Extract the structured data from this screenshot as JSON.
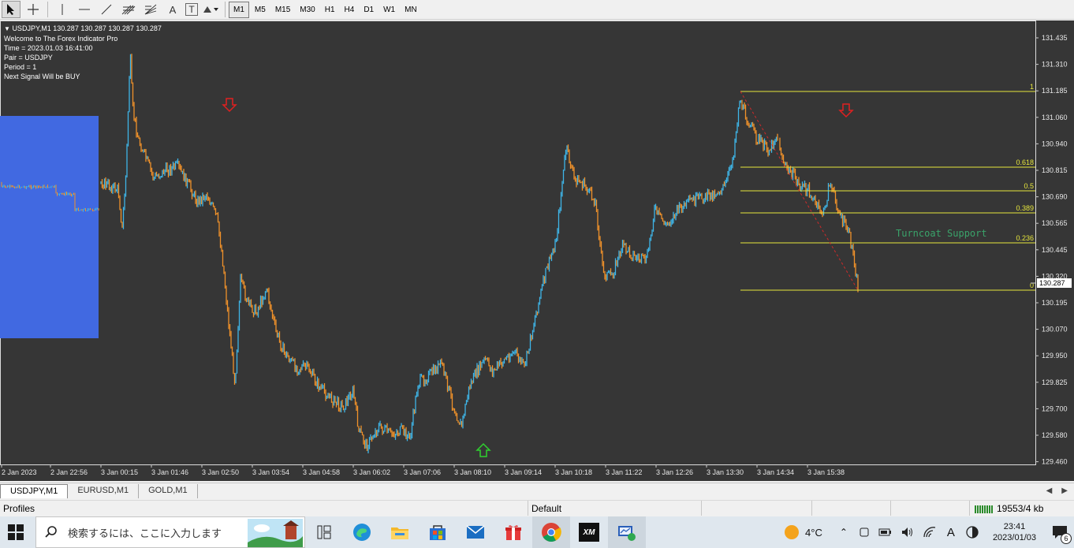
{
  "toolbar": {
    "tools": [
      "cursor-icon",
      "crosshair-icon",
      "vertical-line-icon",
      "horizontal-line-icon",
      "trendline-icon",
      "fibonacci-channel-icon",
      "fibonacci-fan-icon",
      "text-icon",
      "text-label-icon",
      "arrows-icon"
    ],
    "text_tool_label": "A",
    "label_tool_label": "T",
    "timeframes": [
      "M1",
      "M5",
      "M15",
      "M30",
      "H1",
      "H4",
      "D1",
      "W1",
      "MN"
    ],
    "active_timeframe": "M1"
  },
  "chart": {
    "header": "USDJPY,M1  130.287 130.287 130.287 130.287",
    "indicator_lines": [
      "Welcome to The Forex Indicator Pro",
      "Time = 2023.01.03 16:41:00",
      "Pair = USDJPY",
      "Period = 1",
      "Next Signal Will be BUY"
    ],
    "price_ticks": [
      "131.435",
      "131.310",
      "131.185",
      "131.060",
      "130.940",
      "130.815",
      "130.690",
      "130.565",
      "130.445",
      "130.320",
      "130.195",
      "130.070",
      "129.950",
      "129.825",
      "129.700",
      "129.580",
      "129.460"
    ],
    "current_price": "130.287",
    "time_ticks": [
      "2 Jan 2023",
      "2 Jan 22:56",
      "3 Jan 00:15",
      "3 Jan 01:46",
      "3 Jan 02:50",
      "3 Jan 03:54",
      "3 Jan 04:58",
      "3 Jan 06:02",
      "3 Jan 07:06",
      "3 Jan 08:10",
      "3 Jan 09:14",
      "3 Jan 10:18",
      "3 Jan 11:22",
      "3 Jan 12:26",
      "3 Jan 13:30",
      "3 Jan 14:34",
      "3 Jan 15:38"
    ],
    "fib_levels": [
      "1",
      "0.618",
      "0.5",
      "0.389",
      "0.236",
      "0"
    ],
    "support_label": "Turncoat Support",
    "colors": {
      "background": "#363636",
      "bull": "#3fb6e8",
      "bear": "#f0922a",
      "fib": "#e6e63c",
      "support_text": "#3aa36a",
      "sell_arrow": "#e02020",
      "buy_arrow": "#2fd02f",
      "panel": "#4169e1"
    }
  },
  "tabs": [
    "USDJPY,M1",
    "EURUSD,M1",
    "GOLD,M1"
  ],
  "active_tab": "USDJPY,M1",
  "status": {
    "profiles": "Profiles",
    "profile_name": "Default",
    "traffic": "19553/4 kb"
  },
  "taskbar": {
    "search_placeholder": "検索するには、ここに入力します",
    "apps": [
      "task-view-icon",
      "edge-icon",
      "file-explorer-icon",
      "store-icon",
      "mail-icon",
      "gift-icon",
      "chrome-icon",
      "xm-icon",
      "metatrader-icon"
    ],
    "xm_label": "XM",
    "weather": "4°C",
    "ime": "A",
    "time": "23:41",
    "date": "2023/01/03",
    "notifications": "6"
  }
}
